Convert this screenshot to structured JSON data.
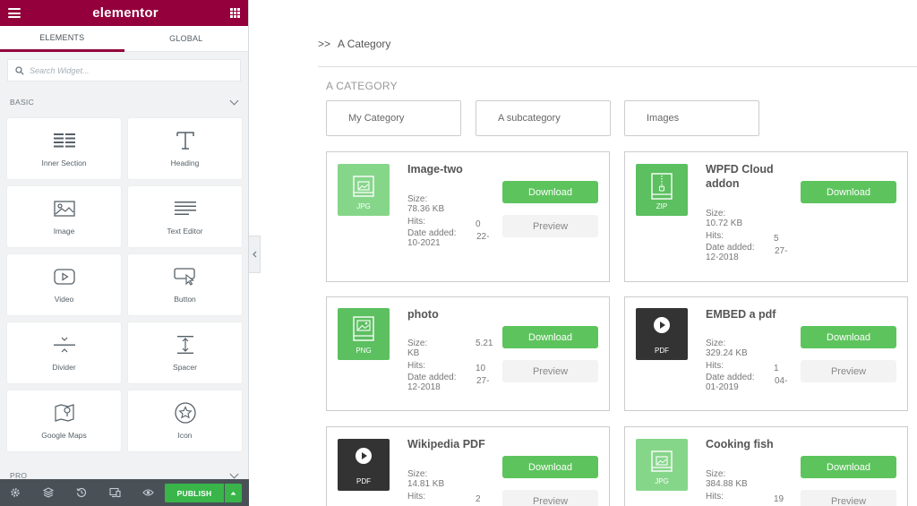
{
  "sidebar": {
    "brand": "elementor",
    "tabs": [
      "ELEMENTS",
      "GLOBAL"
    ],
    "search_placeholder": "Search Widget...",
    "section_basic": "BASIC",
    "section_pro": "PRO",
    "widgets": [
      "Inner Section",
      "Heading",
      "Image",
      "Text Editor",
      "Video",
      "Button",
      "Divider",
      "Spacer",
      "Google Maps",
      "Icon"
    ],
    "publish_label": "PUBLISH"
  },
  "main": {
    "breadcrumb_arrow": ">>",
    "breadcrumb": "A Category",
    "category_title": "A CATEGORY",
    "categories": [
      "My Category",
      "A subcategory",
      "Images"
    ],
    "labels": {
      "size": "Size:",
      "hits": "Hits:",
      "date": "Date added:",
      "download": "Download",
      "preview": "Preview"
    },
    "files": [
      {
        "name": "Image-two",
        "ext": "JPG",
        "color": "#86d68a",
        "size_line1": "",
        "size_line2": "78.36 KB",
        "hits": "0",
        "date_line1": "22-",
        "date_line2": "10-2021"
      },
      {
        "name": "WPFD Cloud addon",
        "ext": "ZIP",
        "color": "#5cbf60",
        "size_line1": "",
        "size_line2": "10.72 KB",
        "hits": "5",
        "date_line1": "27-",
        "date_line2": "12-2018"
      },
      {
        "name": "photo",
        "ext": "PNG",
        "color": "#5cbf60",
        "size_line1": "5.21",
        "size_line2": "KB",
        "hits": "10",
        "date_line1": "27-",
        "date_line2": "12-2018"
      },
      {
        "name": "EMBED a pdf",
        "ext": "PDF",
        "color": "#333333",
        "size_line1": "",
        "size_line2": "329.24 KB",
        "hits": "1",
        "date_line1": "04-",
        "date_line2": "01-2019"
      },
      {
        "name": "Wikipedia PDF",
        "ext": "PDF",
        "color": "#333333",
        "size_line1": "",
        "size_line2": "14.81 KB",
        "hits": "2",
        "date_line1": "",
        "date_line2": ""
      },
      {
        "name": "Cooking fish",
        "ext": "JPG",
        "color": "#86d68a",
        "size_line1": "",
        "size_line2": "384.88 KB",
        "hits": "19",
        "date_line1": "",
        "date_line2": ""
      }
    ]
  }
}
